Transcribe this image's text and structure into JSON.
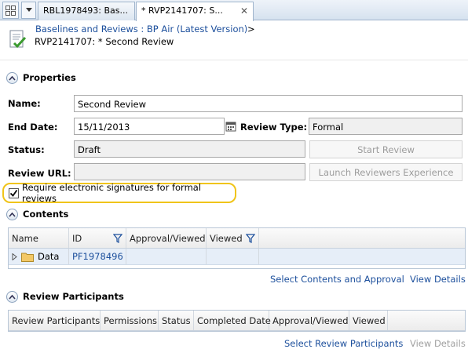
{
  "tabs": [
    {
      "label": "RBL1978493: Bas..."
    },
    {
      "label": "* RVP2141707: S...",
      "close": "✕"
    }
  ],
  "header": {
    "breadcrumb": "Baselines and Reviews : BP Air (Latest Version)",
    "breadcrumb_separator": ">",
    "subtitle": "RVP2141707: * Second Review"
  },
  "properties": {
    "section_title": "Properties",
    "name_label": "Name:",
    "name_value": "Second Review",
    "end_date_label": "End Date:",
    "end_date_value": "15/11/2013",
    "review_type_label": "Review Type:",
    "review_type_value": "Formal",
    "status_label": "Status:",
    "status_value": "Draft",
    "start_review_button": "Start Review",
    "review_url_label": "Review URL:",
    "review_url_value": "",
    "launch_button": "Launch Reviewers Experience",
    "require_signatures_label": "Require electronic signatures for formal reviews",
    "require_signatures_checked": true
  },
  "contents": {
    "section_title": "Contents",
    "columns": [
      "Name",
      "ID",
      "Approval/Viewed",
      "Viewed"
    ],
    "rows": [
      {
        "name": "Data",
        "id": "PF1978496",
        "approval": "",
        "viewed": ""
      }
    ],
    "select_link": "Select Contents and Approval",
    "view_details_link": "View Details"
  },
  "participants": {
    "section_title": "Review Participants",
    "columns": [
      "Review Participants",
      "Permissions",
      "Status",
      "Completed Date",
      "Approval/Viewed",
      "Viewed"
    ],
    "select_link": "Select Review Participants",
    "view_details_link": "View Details"
  },
  "colors": {
    "link": "#1c4f9c",
    "highlight_border": "#f0c419",
    "row_selected": "#e6eef8"
  }
}
